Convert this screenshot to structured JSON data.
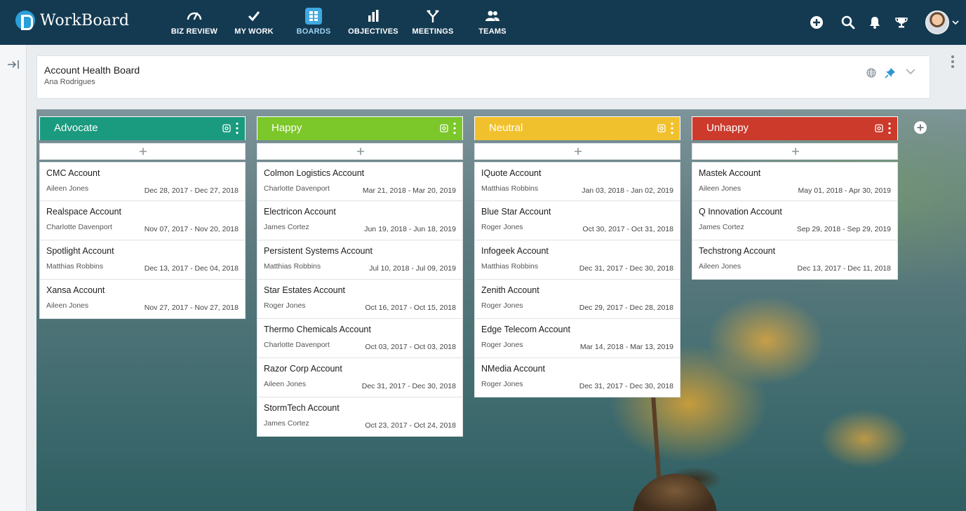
{
  "app": {
    "name": "WorkBoard"
  },
  "nav": [
    {
      "label": "BIZ REVIEW",
      "icon": "gauge-icon"
    },
    {
      "label": "MY WORK",
      "icon": "checkmark-icon"
    },
    {
      "label": "BOARDS",
      "icon": "boards-grid-icon",
      "active": true
    },
    {
      "label": "OBJECTIVES",
      "icon": "bar-chart-icon"
    },
    {
      "label": "MEETINGS",
      "icon": "fork-icon"
    },
    {
      "label": "TEAMS",
      "icon": "people-icon"
    }
  ],
  "top_actions": [
    "add-circle-icon",
    "search-icon",
    "bell-icon",
    "trophy-icon"
  ],
  "header": {
    "title": "Account Health Board",
    "owner": "Ana Rodrigues"
  },
  "colors": {
    "navy": "#143a52",
    "advocate": "#1a9a7e",
    "happy": "#7cc729",
    "neutral": "#f1c12d",
    "unhappy": "#cc3a2c"
  },
  "columns": [
    {
      "title": "Advocate",
      "color": "#1a9a7e",
      "cards": [
        {
          "name": "CMC Account",
          "owner": "Aileen Jones",
          "dates": "Dec 28, 2017 - Dec 27, 2018"
        },
        {
          "name": "Realspace Account",
          "owner": "Charlotte Davenport",
          "dates": "Nov 07, 2017 - Nov 20, 2018"
        },
        {
          "name": "Spotlight Account",
          "owner": "Matthias Robbins",
          "dates": "Dec 13, 2017 - Dec 04, 2018"
        },
        {
          "name": "Xansa Account",
          "owner": "Aileen Jones",
          "dates": "Nov 27, 2017 - Nov 27, 2018"
        }
      ]
    },
    {
      "title": "Happy",
      "color": "#7cc729",
      "cards": [
        {
          "name": "Colmon Logistics Account",
          "owner": "Charlotte Davenport",
          "dates": "Mar 21, 2018 - Mar 20, 2019"
        },
        {
          "name": "Electricon Account",
          "owner": "James Cortez",
          "dates": "Jun 19, 2018 - Jun 18, 2019"
        },
        {
          "name": "Persistent Systems Account",
          "owner": "Matthias Robbins",
          "dates": "Jul 10, 2018 - Jul 09, 2019"
        },
        {
          "name": "Star Estates Account",
          "owner": "Roger Jones",
          "dates": "Oct 16, 2017 - Oct 15, 2018"
        },
        {
          "name": "Thermo Chemicals Account",
          "owner": "Charlotte Davenport",
          "dates": "Oct 03, 2017 - Oct 03, 2018"
        },
        {
          "name": "Razor Corp Account",
          "owner": "Aileen Jones",
          "dates": "Dec 31, 2017 - Dec 30, 2018"
        },
        {
          "name": "StormTech Account",
          "owner": "James Cortez",
          "dates": "Oct 23, 2017 - Oct 24, 2018"
        }
      ]
    },
    {
      "title": "Neutral",
      "color": "#f1c12d",
      "cards": [
        {
          "name": "IQuote Account",
          "owner": "Matthias Robbins",
          "dates": "Jan 03, 2018 - Jan 02, 2019"
        },
        {
          "name": "Blue Star Account",
          "owner": "Roger Jones",
          "dates": "Oct 30, 2017 - Oct 31, 2018"
        },
        {
          "name": "Infogeek Account",
          "owner": "Matthias Robbins",
          "dates": "Dec 31, 2017 - Dec 30, 2018"
        },
        {
          "name": "Zenith Account",
          "owner": "Roger Jones",
          "dates": "Dec 29, 2017 - Dec 28, 2018"
        },
        {
          "name": "Edge Telecom Account",
          "owner": "Roger Jones",
          "dates": "Mar 14, 2018 - Mar 13, 2019"
        },
        {
          "name": "NMedia Account",
          "owner": "Roger Jones",
          "dates": "Dec 31, 2017 - Dec 30, 2018"
        }
      ]
    },
    {
      "title": "Unhappy",
      "color": "#cc3a2c",
      "cards": [
        {
          "name": "Mastek Account",
          "owner": "Aileen Jones",
          "dates": "May 01, 2018 - Apr 30, 2019"
        },
        {
          "name": "Q Innovation Account",
          "owner": "James Cortez",
          "dates": "Sep 29, 2018 - Sep 29, 2019"
        },
        {
          "name": "Techstrong Account",
          "owner": "Aileen Jones",
          "dates": "Dec 13, 2017 - Dec 11, 2018"
        }
      ]
    }
  ]
}
